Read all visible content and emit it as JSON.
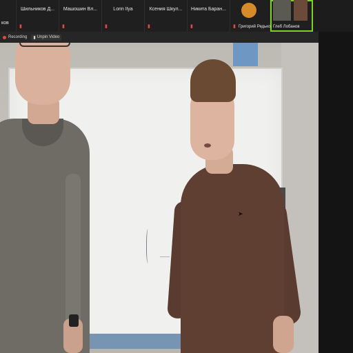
{
  "participants": [
    {
      "name": "ков",
      "width": 24
    },
    {
      "name": "Шильников Д...",
      "width": 62
    },
    {
      "name": "Машошин Вл...",
      "width": 62
    },
    {
      "name": "Lorin Ilya",
      "width": 62
    },
    {
      "name": "Ксения Шкул...",
      "width": 62
    },
    {
      "name": "Никита Баран...",
      "width": 62
    }
  ],
  "video_tiles": [
    {
      "name": "Григорий Редько"
    },
    {
      "name": "Глеб Лобанов"
    }
  ],
  "status": {
    "recording": "Recording",
    "view": "Unpin Video"
  },
  "colors": {
    "muted": "#e5483e",
    "speaking": "#7ed321"
  }
}
